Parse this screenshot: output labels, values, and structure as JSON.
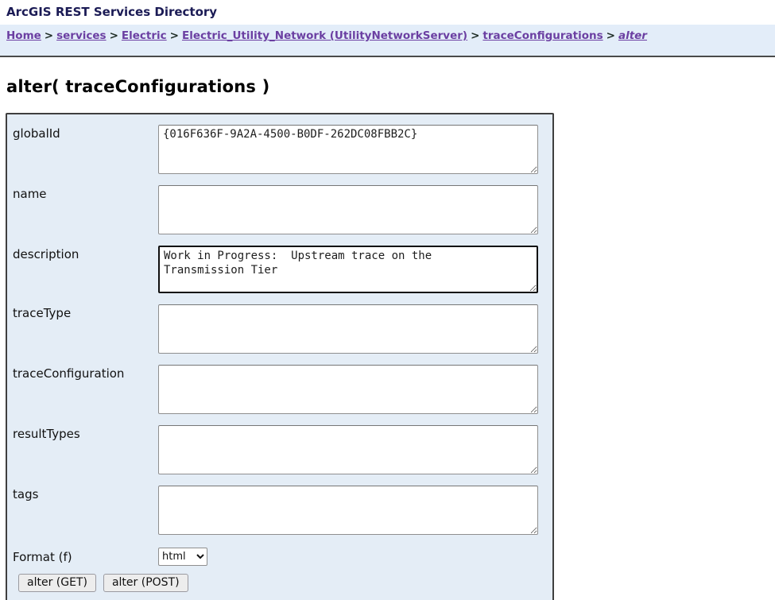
{
  "page": {
    "title": "ArcGIS REST Services Directory",
    "heading": "alter( traceConfigurations )"
  },
  "breadcrumb": {
    "separator": ">",
    "items": [
      {
        "label": "Home"
      },
      {
        "label": "services"
      },
      {
        "label": "Electric"
      },
      {
        "label": "Electric_Utility_Network (UtilityNetworkServer)"
      },
      {
        "label": "traceConfigurations"
      },
      {
        "label": "alter"
      }
    ]
  },
  "form": {
    "fields": [
      {
        "label": "globalId",
        "value": "{016F636F-9A2A-4500-B0DF-262DC08FBB2C}"
      },
      {
        "label": "name",
        "value": ""
      },
      {
        "label": "description",
        "value": "Work in Progress:  Upstream trace on the\nTransmission Tier"
      },
      {
        "label": "traceType",
        "value": ""
      },
      {
        "label": "traceConfiguration",
        "value": ""
      },
      {
        "label": "resultTypes",
        "value": ""
      },
      {
        "label": "tags",
        "value": ""
      }
    ],
    "format": {
      "label": "Format (f)",
      "value": "html"
    },
    "buttons": [
      {
        "label": "alter (GET)"
      },
      {
        "label": "alter (POST)"
      }
    ]
  },
  "colors": {
    "link": "#6b3fa2",
    "breadcrumb_bg": "#e3edf9",
    "panel_bg": "#e4edf6",
    "title_text": "#1b1b55"
  }
}
